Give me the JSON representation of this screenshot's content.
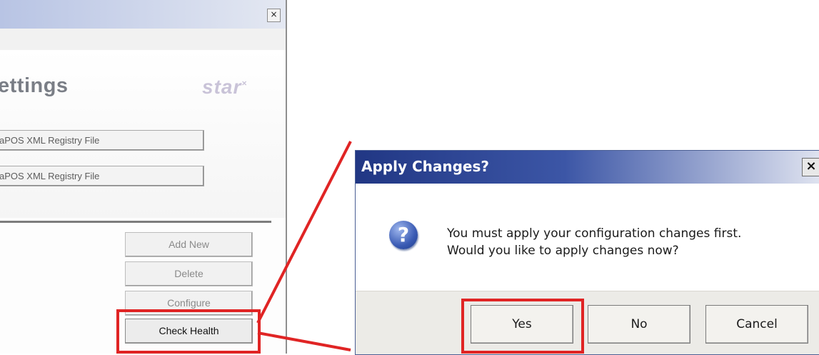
{
  "settings_window": {
    "close_glyph": "×",
    "title_fragment": "ettings",
    "logo_text": "star",
    "logo_mark": "×",
    "file_buttons": [
      "aPOS XML Registry File",
      "aPOS XML Registry File"
    ],
    "side_buttons": {
      "add_new": "Add New",
      "delete": "Delete",
      "configure": "Configure",
      "check_health": "Check Health"
    }
  },
  "dialog": {
    "title": "Apply Changes?",
    "close_glyph": "×",
    "icon": "question-icon",
    "icon_glyph": "?",
    "message_line1": "You must apply your configuration changes first.",
    "message_line2": "Would you like to apply changes now?",
    "buttons": {
      "yes": "Yes",
      "no": "No",
      "cancel": "Cancel"
    }
  },
  "colors": {
    "highlight": "#e02424",
    "dialog_title_start": "#213784",
    "dialog_title_end": "#dfe3f0"
  }
}
